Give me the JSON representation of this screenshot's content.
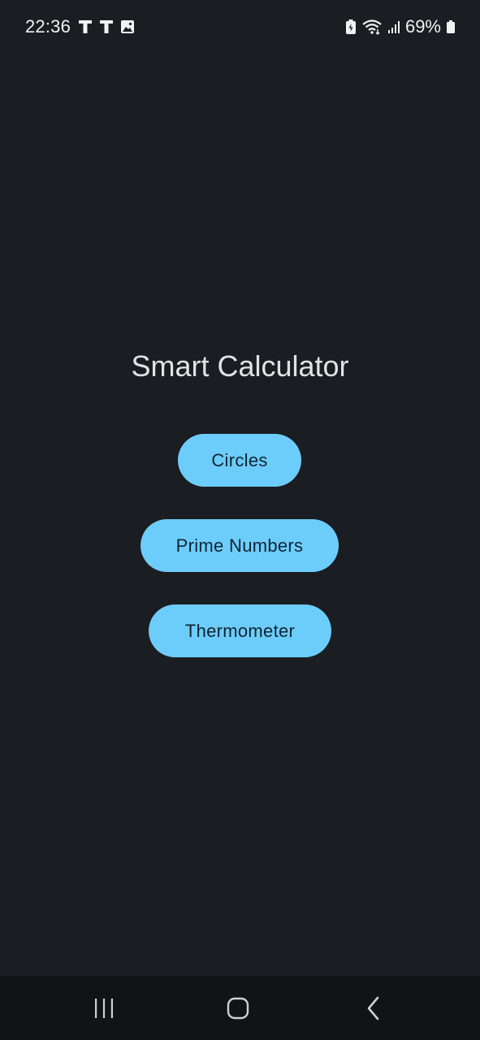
{
  "status_bar": {
    "time": "22:36",
    "notification_icons": [
      "t-icon",
      "t-icon",
      "image-icon"
    ],
    "system_icons": [
      "battery-saver-icon",
      "wifi-icon",
      "signal-icon"
    ],
    "battery_percent": "69%"
  },
  "main": {
    "title": "Smart Calculator",
    "buttons": [
      {
        "label": "Circles"
      },
      {
        "label": "Prime Numbers"
      },
      {
        "label": "Thermometer"
      }
    ]
  },
  "nav_bar": {
    "icons": [
      "recents-icon",
      "home-icon",
      "back-icon"
    ]
  },
  "colors": {
    "background": "#1a1d21",
    "button_fill": "#6dcdfa",
    "button_text": "#0f2433",
    "nav_background": "#111315"
  }
}
